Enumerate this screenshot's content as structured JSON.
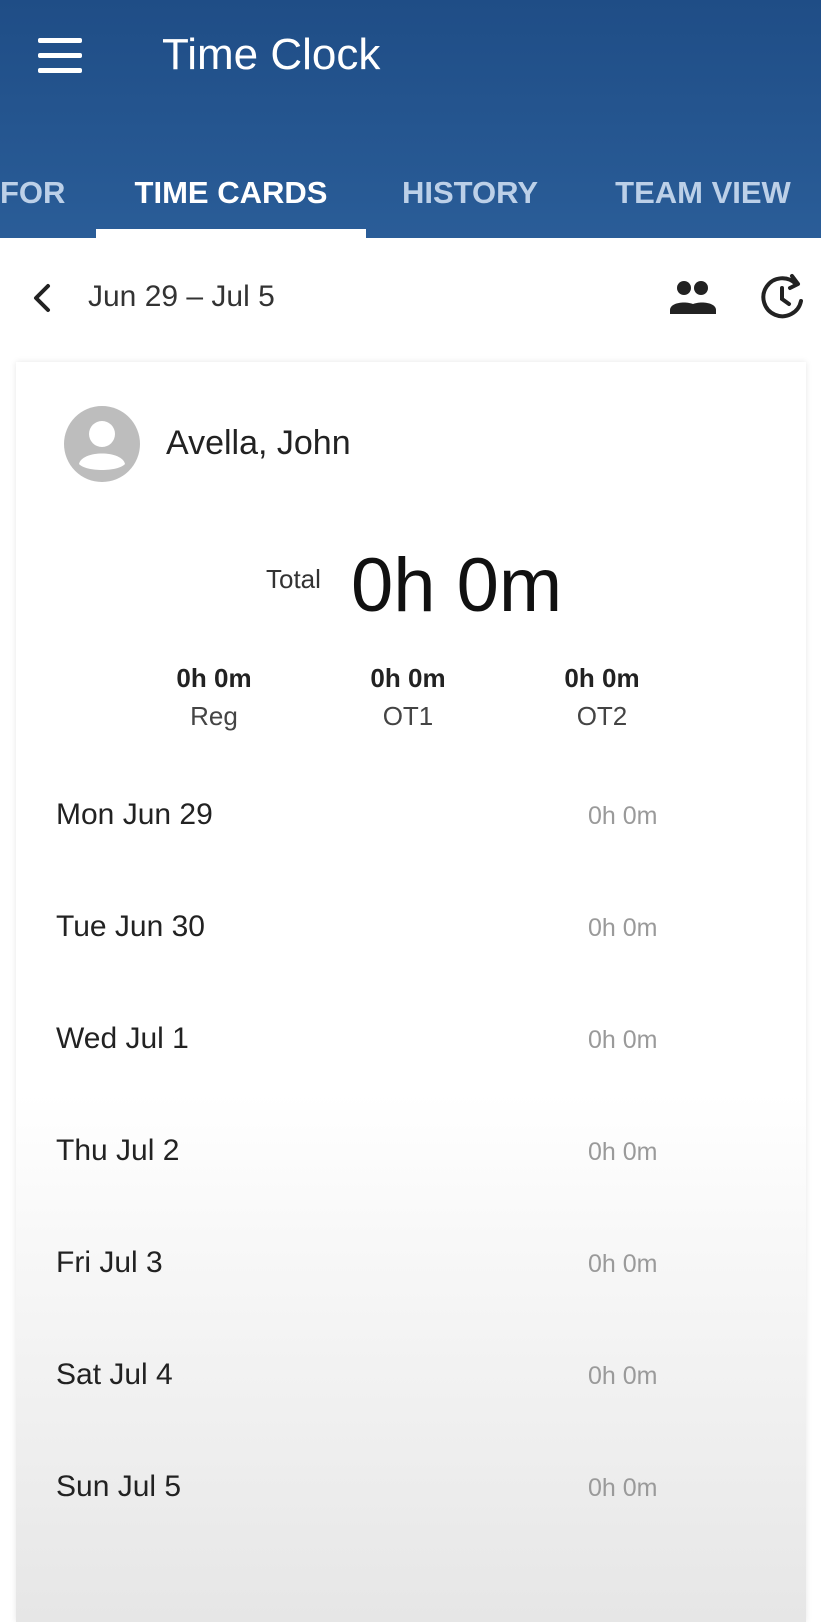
{
  "appbar": {
    "title": "Time Clock",
    "menu_icon": "hamburger-menu-icon"
  },
  "tabs": [
    {
      "label": "FOR",
      "active": false
    },
    {
      "label": "TIME CARDS",
      "active": true
    },
    {
      "label": "HISTORY",
      "active": false
    },
    {
      "label": "TEAM VIEW",
      "active": false
    }
  ],
  "week": {
    "range": "Jun 29 – Jul 5",
    "back_icon": "chevron-left-icon",
    "team_icon": "people-icon",
    "history_icon": "clock-history-icon"
  },
  "employee": {
    "name": "Avella, John",
    "avatar_icon": "person-avatar-icon"
  },
  "totals": {
    "label": "Total",
    "value": "0h 0m",
    "buckets": [
      {
        "value": "0h 0m",
        "label": "Reg"
      },
      {
        "value": "0h 0m",
        "label": "OT1"
      },
      {
        "value": "0h 0m",
        "label": "OT2"
      }
    ]
  },
  "days": [
    {
      "label": "Mon Jun 29",
      "value": "0h 0m"
    },
    {
      "label": "Tue Jun 30",
      "value": "0h 0m"
    },
    {
      "label": "Wed Jul 1",
      "value": "0h 0m"
    },
    {
      "label": "Thu Jul 2",
      "value": "0h 0m"
    },
    {
      "label": "Fri Jul 3",
      "value": "0h 0m"
    },
    {
      "label": "Sat Jul 4",
      "value": "0h 0m"
    },
    {
      "label": "Sun Jul 5",
      "value": "0h 0m"
    }
  ],
  "colors": {
    "appbar": "#2a5d98",
    "tab_active": "#ffffff",
    "tab_inactive": "#bcd0e8",
    "muted_value": "#9a9a9a"
  }
}
